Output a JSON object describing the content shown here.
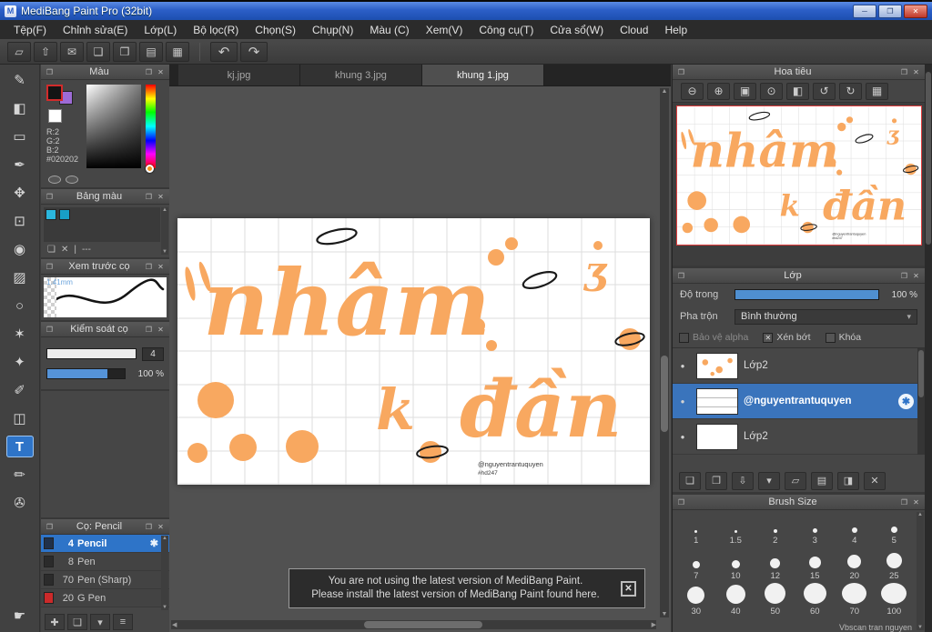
{
  "titlebar": {
    "title": "MediBang Paint Pro (32bit)",
    "app_initial": "M",
    "minimize": "─",
    "maximize": "❐",
    "close": "✕"
  },
  "menu": {
    "items": [
      "Tệp(F)",
      "Chỉnh sửa(E)",
      "Lớp(L)",
      "Bộ lọc(R)",
      "Chọn(S)",
      "Chụp(N)",
      "Màu (C)",
      "Xem(V)",
      "Công cụ(T)",
      "Cửa sổ(W)",
      "Cloud",
      "Help"
    ]
  },
  "toolbar": {
    "icons": [
      {
        "name": "select-area-icon",
        "glyph": "▱"
      },
      {
        "name": "export-icon",
        "glyph": "⇧"
      },
      {
        "name": "message-icon",
        "glyph": "✉"
      },
      {
        "name": "messages-icon",
        "glyph": "❑"
      },
      {
        "name": "document-icon",
        "glyph": "❒"
      },
      {
        "name": "documents-icon",
        "glyph": "▤"
      },
      {
        "name": "grid-icon",
        "glyph": "▦"
      }
    ],
    "undo": "↶",
    "redo": "↷"
  },
  "tools": [
    {
      "name": "pen-tool",
      "glyph": "✎"
    },
    {
      "name": "eraser-tool",
      "glyph": "◧"
    },
    {
      "name": "shape-brush-tool",
      "glyph": "▭"
    },
    {
      "name": "ink-pen-tool",
      "glyph": "✒"
    },
    {
      "name": "move-tool",
      "glyph": "✥"
    },
    {
      "name": "select-tool",
      "glyph": "⊡"
    },
    {
      "name": "bucket-tool",
      "glyph": "◉"
    },
    {
      "name": "gradient-tool",
      "glyph": "▨"
    },
    {
      "name": "lasso-tool",
      "glyph": "○"
    },
    {
      "name": "magic-wand-tool",
      "glyph": "✶"
    },
    {
      "name": "operation-tool",
      "glyph": "✦"
    },
    {
      "name": "pen-edit-tool",
      "glyph": "✐"
    },
    {
      "name": "divide-tool",
      "glyph": "◫"
    },
    {
      "name": "text-tool",
      "glyph": "T"
    },
    {
      "name": "select-pen-tool",
      "glyph": "✏"
    },
    {
      "name": "eyedropper-tool",
      "glyph": "✇"
    },
    {
      "name": "hand-tool",
      "glyph": "☛"
    }
  ],
  "tabs": {
    "items": [
      "kj.jpg",
      "khung 3.jpg",
      "khung 1.jpg"
    ]
  },
  "color_panel": {
    "title": "Màu",
    "r": "R:2",
    "g": "G:2",
    "b": "B:2",
    "hex": "#020202"
  },
  "palette_panel": {
    "title": "Bảng màu",
    "placeholder": "---",
    "swatch1": "#2bb6dd",
    "swatch2": "#189fc6"
  },
  "preview_panel": {
    "title": "Xem trước cọ",
    "size_label": "1.41mm"
  },
  "control_panel": {
    "title": "Kiểm soát cọ",
    "size_value": "4",
    "opacity_value": "100 %"
  },
  "brush_panel": {
    "title": "Cọ: Pencil",
    "brushes": [
      {
        "size": "4",
        "name": "Pencil"
      },
      {
        "size": "8",
        "name": "Pen"
      },
      {
        "size": "70",
        "name": "Pen (Sharp)"
      },
      {
        "size": "20",
        "name": "G Pen"
      }
    ]
  },
  "navigator_panel": {
    "title": "Hoa tiêu"
  },
  "layer_panel": {
    "title": "Lớp",
    "opacity_label": "Độ trong",
    "opacity_value": "100 %",
    "blend_label": "Pha trộn",
    "blend_value": "Bình thường",
    "checkboxes": [
      "Bảo vệ alpha",
      "Xén bớt",
      "Khóa"
    ],
    "layers": [
      "Lớp2",
      "@nguyentrantuquyen",
      "Lớp2"
    ]
  },
  "size_panel": {
    "title": "Brush Size",
    "sizes": [
      "1",
      "1.5",
      "2",
      "3",
      "4",
      "5",
      "7",
      "10",
      "12",
      "15",
      "20",
      "25",
      "30",
      "40",
      "50",
      "60",
      "70",
      "100"
    ],
    "partial_text": "Vbscan tran nguyen"
  },
  "canvas": {
    "word1": "nhâm",
    "word2": "k",
    "word3": "đần",
    "watermark1": "@nguyentrantuquyen",
    "watermark2": "#hd247"
  },
  "notification": {
    "line1": "You are not using the latest version of MediBang Paint.",
    "line2": "Please install the latest version of MediBang Paint found here.",
    "close": "✕"
  },
  "icons": {
    "popout": "❐",
    "close": "✕",
    "up": "▲",
    "down": "▼",
    "left": "◀",
    "right": "▶",
    "gear": "✱",
    "caret": "▾",
    "dot": "●",
    "check_x": "✕",
    "add": "❏",
    "trash": "✕",
    "sep": "|",
    "add_brush": "✚",
    "menu_caret": "▾",
    "list": "≡",
    "duplicate": "❐",
    "transfer": "⇩",
    "folder": "▱",
    "merge": "▤",
    "mask": "◨"
  },
  "nav_icons": [
    {
      "name": "zoom-out-button",
      "glyph": "⊖"
    },
    {
      "name": "zoom-in-button",
      "glyph": "⊕"
    },
    {
      "name": "fit-screen-button",
      "glyph": "▣"
    },
    {
      "name": "zoom-reset-button",
      "glyph": "⊙"
    },
    {
      "name": "flip-button",
      "glyph": "◧"
    },
    {
      "name": "rotate-left-button",
      "glyph": "↺"
    },
    {
      "name": "rotate-right-button",
      "glyph": "↻"
    },
    {
      "name": "reset-view-button",
      "glyph": "▦"
    }
  ],
  "colors": {
    "titlebar_blue": "#2c5fc7",
    "accent_blue": "#2e74c8",
    "artwork_orange": "#f8a860",
    "thumb_border_red": "#e03c3c",
    "palette_cyan": "#2bb6dd"
  }
}
